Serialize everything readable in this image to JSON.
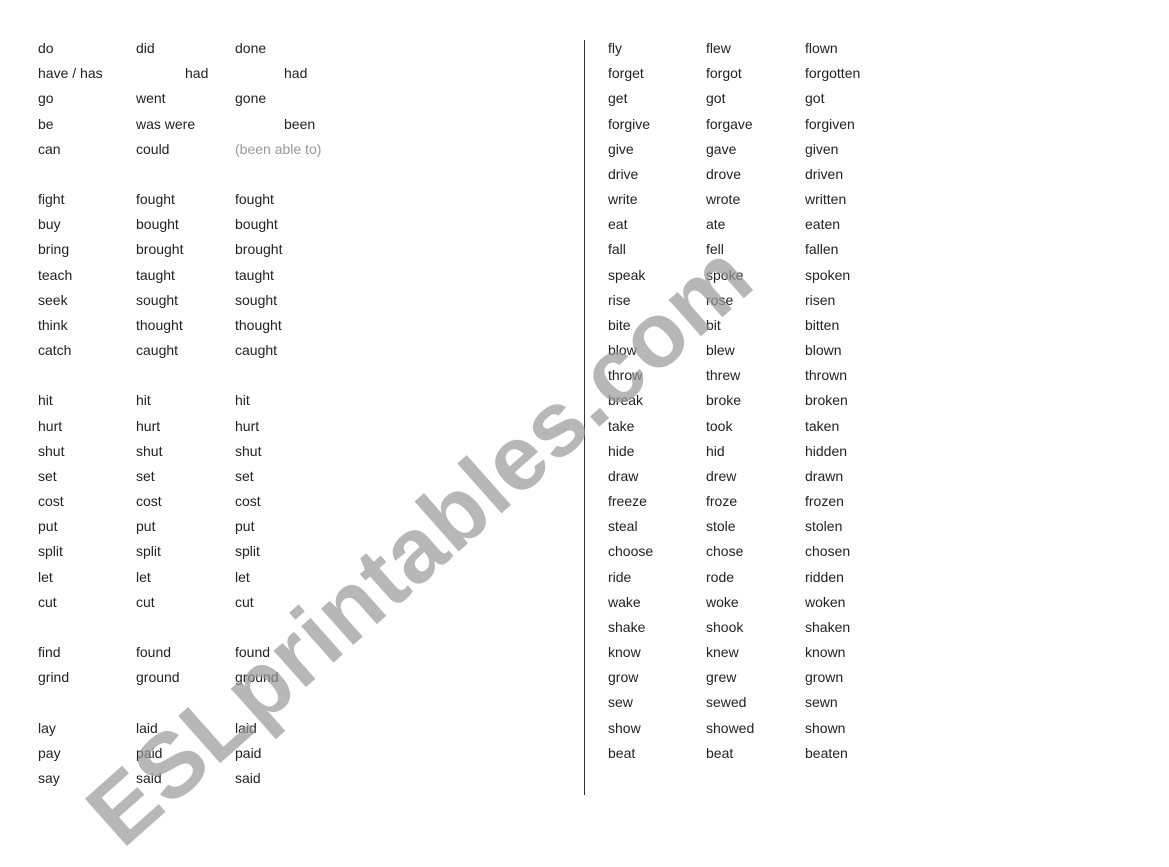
{
  "left_column": [
    [
      "do",
      "did",
      "done"
    ],
    [
      "have / has",
      "had",
      "had"
    ],
    [
      "go",
      "went",
      "gone"
    ],
    [
      "be",
      "was were",
      "been"
    ],
    [
      "can",
      "could",
      "(been able to)"
    ],
    null,
    [
      "fight",
      "fought",
      "fought"
    ],
    [
      "buy",
      "bought",
      "bought"
    ],
    [
      "bring",
      "brought",
      "brought"
    ],
    [
      "teach",
      "taught",
      "taught"
    ],
    [
      "seek",
      "sought",
      "sought"
    ],
    [
      "think",
      "thought",
      "thought"
    ],
    [
      "catch",
      "caught",
      "caught"
    ],
    null,
    [
      "hit",
      "hit",
      "hit"
    ],
    [
      "hurt",
      "hurt",
      "hurt"
    ],
    [
      "shut",
      "shut",
      "shut"
    ],
    [
      "set",
      "set",
      "set"
    ],
    [
      "cost",
      "cost",
      "cost"
    ],
    [
      "put",
      "put",
      "put"
    ],
    [
      "split",
      "split",
      "split"
    ],
    [
      "let",
      "let",
      "let"
    ],
    [
      "cut",
      "cut",
      "cut"
    ],
    null,
    [
      "find",
      "found",
      "found"
    ],
    [
      "grind",
      "ground",
      "ground"
    ],
    null,
    [
      "lay",
      "laid",
      "laid"
    ],
    [
      "pay",
      "paid",
      "paid"
    ],
    [
      "say",
      "said",
      "said"
    ]
  ],
  "right_column": [
    [
      "fly",
      "flew",
      "flown"
    ],
    [
      "forget",
      "forgot",
      "forgotten"
    ],
    [
      "get",
      "got",
      "got"
    ],
    [
      "forgive",
      "forgave",
      "forgiven"
    ],
    [
      "give",
      "gave",
      "given"
    ],
    [
      "drive",
      "drove",
      "driven"
    ],
    [
      "write",
      "wrote",
      "written"
    ],
    [
      "eat",
      "ate",
      "eaten"
    ],
    [
      "fall",
      "fell",
      "fallen"
    ],
    [
      "speak",
      "spoke",
      "spoken"
    ],
    [
      "rise",
      "rose",
      "risen"
    ],
    [
      "bite",
      "bit",
      "bitten"
    ],
    [
      "blow",
      "blew",
      "blown"
    ],
    [
      "throw",
      "threw",
      "thrown"
    ],
    [
      "break",
      "broke",
      "broken"
    ],
    [
      "take",
      "took",
      "taken"
    ],
    [
      "hide",
      "hid",
      "hidden"
    ],
    [
      "draw",
      "drew",
      "drawn"
    ],
    [
      "freeze",
      "froze",
      "frozen"
    ],
    [
      "steal",
      "stole",
      "stolen"
    ],
    [
      "choose",
      "chose",
      "chosen"
    ],
    [
      "ride",
      "rode",
      "ridden"
    ],
    [
      "wake",
      "woke",
      "woken"
    ],
    [
      "shake",
      "shook",
      "shaken"
    ],
    [
      "know",
      "knew",
      "known"
    ],
    [
      "grow",
      "grew",
      "grown"
    ],
    [
      "sew",
      "sewed",
      "sewn"
    ],
    [
      "show",
      "showed",
      "shown"
    ],
    [
      "beat",
      "beat",
      "beaten"
    ]
  ],
  "watermark": "ESLprintables.com",
  "colors": {
    "text": "#222222",
    "muted": "#999999",
    "watermark": "#9a9a9a"
  }
}
